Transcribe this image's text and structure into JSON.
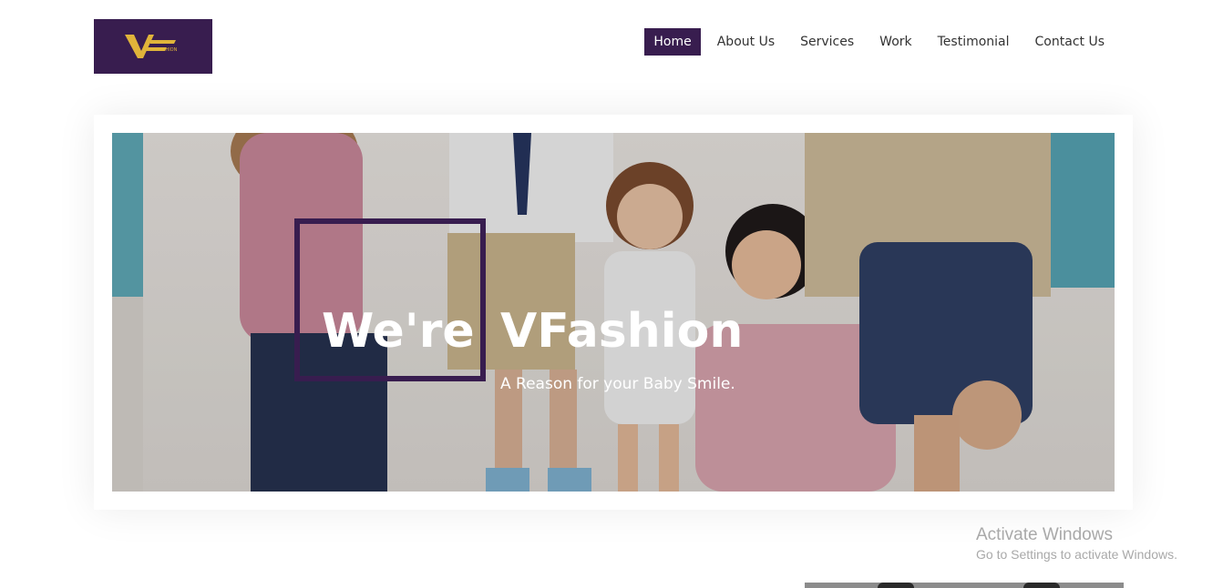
{
  "header": {
    "logo_icon": "vfashion-logo",
    "logo_text": "VFASHION",
    "nav": [
      {
        "label": "Home",
        "active": true
      },
      {
        "label": "About Us",
        "active": false
      },
      {
        "label": "Services",
        "active": false
      },
      {
        "label": "Work",
        "active": false
      },
      {
        "label": "Testimonial",
        "active": false
      },
      {
        "label": "Contact Us",
        "active": false
      }
    ]
  },
  "hero": {
    "title_part1": "We're",
    "title_part2": "VFashion",
    "tagline": "A Reason for your Baby Smile."
  },
  "watermark": {
    "title": "Activate Windows",
    "subtitle": "Go to Settings to activate Windows."
  },
  "colors": {
    "brand": "#381d4f",
    "logo_gold": "#e0b43a",
    "text_dark": "#333333",
    "watermark": "#a9a9a9"
  }
}
